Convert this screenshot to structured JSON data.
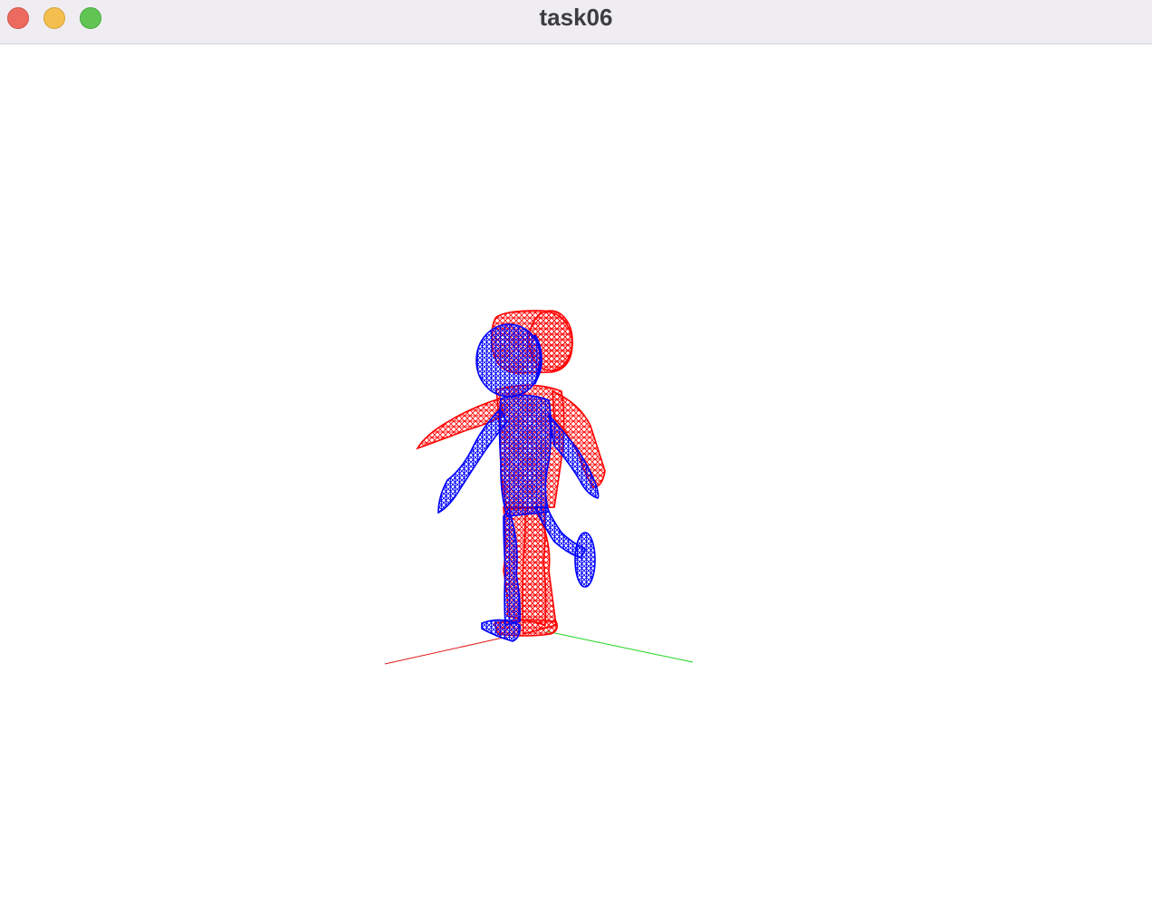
{
  "window": {
    "title": "task06"
  },
  "controls": {
    "close": "close-window",
    "minimize": "minimize-window",
    "maximize": "maximize-window"
  },
  "scene": {
    "background": "#ffffff",
    "axis_x_color": "#e11b1b",
    "axis_y_color": "#1ed31e",
    "current_pose_color": "#0000ff",
    "previous_pose_color": "#ff0000"
  }
}
